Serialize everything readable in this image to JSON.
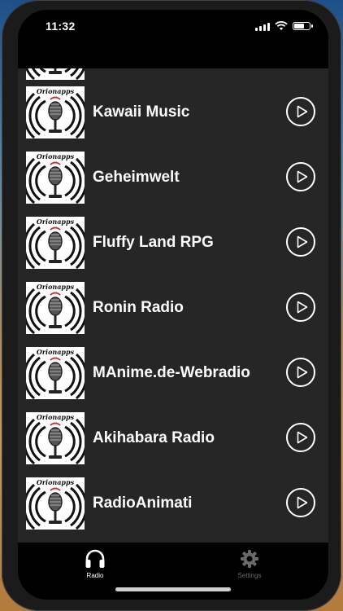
{
  "status": {
    "time": "11:32"
  },
  "stations": [
    {
      "name": ""
    },
    {
      "name": "Kawaii Music"
    },
    {
      "name": "Geheimwelt"
    },
    {
      "name": "Fluffy Land RPG"
    },
    {
      "name": "Ronin Radio"
    },
    {
      "name": "MAnime.de-Webradio"
    },
    {
      "name": "Akihabara Radio"
    },
    {
      "name": "RadioAnimati"
    }
  ],
  "thumb_brand": "Orionapps",
  "tabs": [
    {
      "label": "Radio",
      "icon": "headphones-icon",
      "active": true
    },
    {
      "label": "Settings",
      "icon": "gear-icon",
      "active": false
    }
  ],
  "colors": {
    "list_bg": "#262626",
    "tabbar_bg": "#000000",
    "active_tab": "#ffffff",
    "inactive_tab": "#6a6a6a"
  }
}
